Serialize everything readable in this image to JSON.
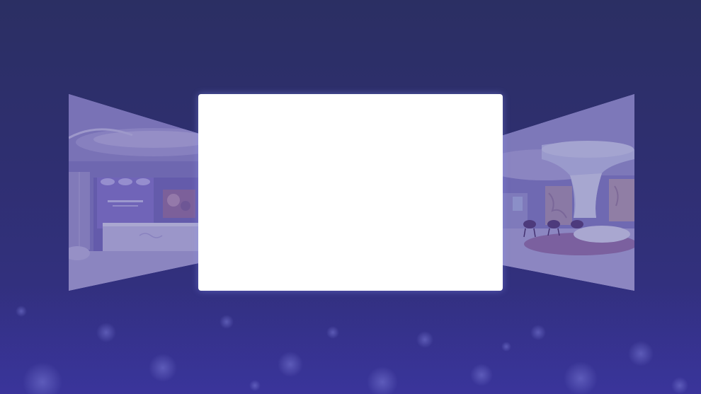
{
  "carousel": {
    "slides": [
      {
        "name": "lobby-reception"
      },
      {
        "name": "featured-blank"
      },
      {
        "name": "lounge-atrium"
      }
    ],
    "active_index": 1
  },
  "colors": {
    "background_top": "#2b2f63",
    "background_bottom": "#35318a",
    "card": "#ffffff",
    "overlay": "#363082"
  }
}
